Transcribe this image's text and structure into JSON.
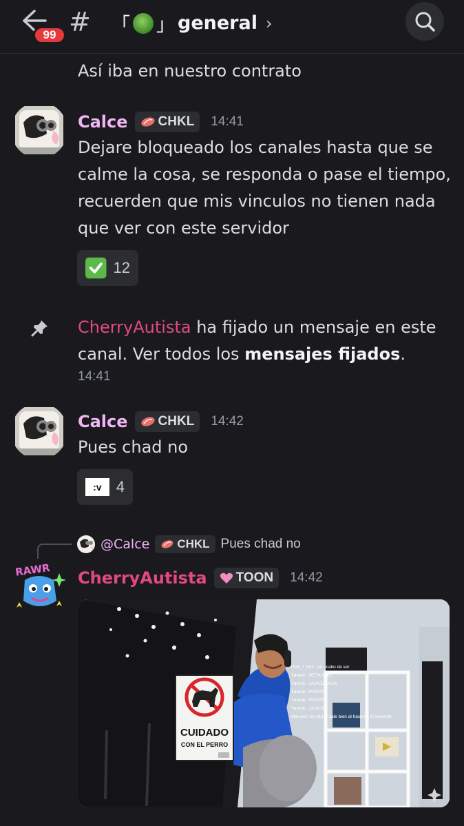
{
  "header": {
    "badge_count": "99",
    "bracket_open": "「",
    "bracket_close": "」",
    "channel_name": "general",
    "chevron": "›",
    "hash": "#"
  },
  "messages": {
    "continued_text": "Así iba en nuestro contrato",
    "msg1": {
      "author": "Calce",
      "author_color": "#f0b5f5",
      "tag": "CHKL",
      "time": "14:41",
      "lines": [
        "Dejare bloqueado los canales hasta que se",
        "calme la cosa, se responda o pase el tiempo,",
        "recuerden que mis vinculos no tienen nada",
        "que ver con este servidor"
      ],
      "reaction_count": "12"
    },
    "pin": {
      "user": "CherryAutista",
      "user_color": "#e24a7c",
      "line1": "ha fijado un mensaje en este",
      "line2_pre": "canal. Ver todos los",
      "link": "mensajes fijados",
      "line2_post": ".",
      "time": "14:41"
    },
    "msg2": {
      "author": "Calce",
      "tag": "CHKL",
      "time": "14:42",
      "text": "Pues chad no",
      "reaction_emoji_label": ":v",
      "reaction_count": "4"
    },
    "msg3": {
      "reply_user": "@Calce",
      "reply_tag": "CHKL",
      "reply_text": "Pues chad no",
      "author": "CherryAutista",
      "tag": "TOON",
      "time": "14:42",
      "image": {
        "sign_title": "CUIDADO",
        "sign_sub": "CON EL PERRO",
        "chat_lines": [
          "Plan_f_582 : ke acabo de ver",
          "Yareeh : NETA AMO",
          "Yareeh : JAJAJJAJAJA",
          "Yareeh : PONTE",
          "Yareeh : PONTE",
          "Yareeh : JAJAJA",
          "Marussi: Ibi rato le sale bien al hacerse el inocente"
        ]
      }
    }
  }
}
